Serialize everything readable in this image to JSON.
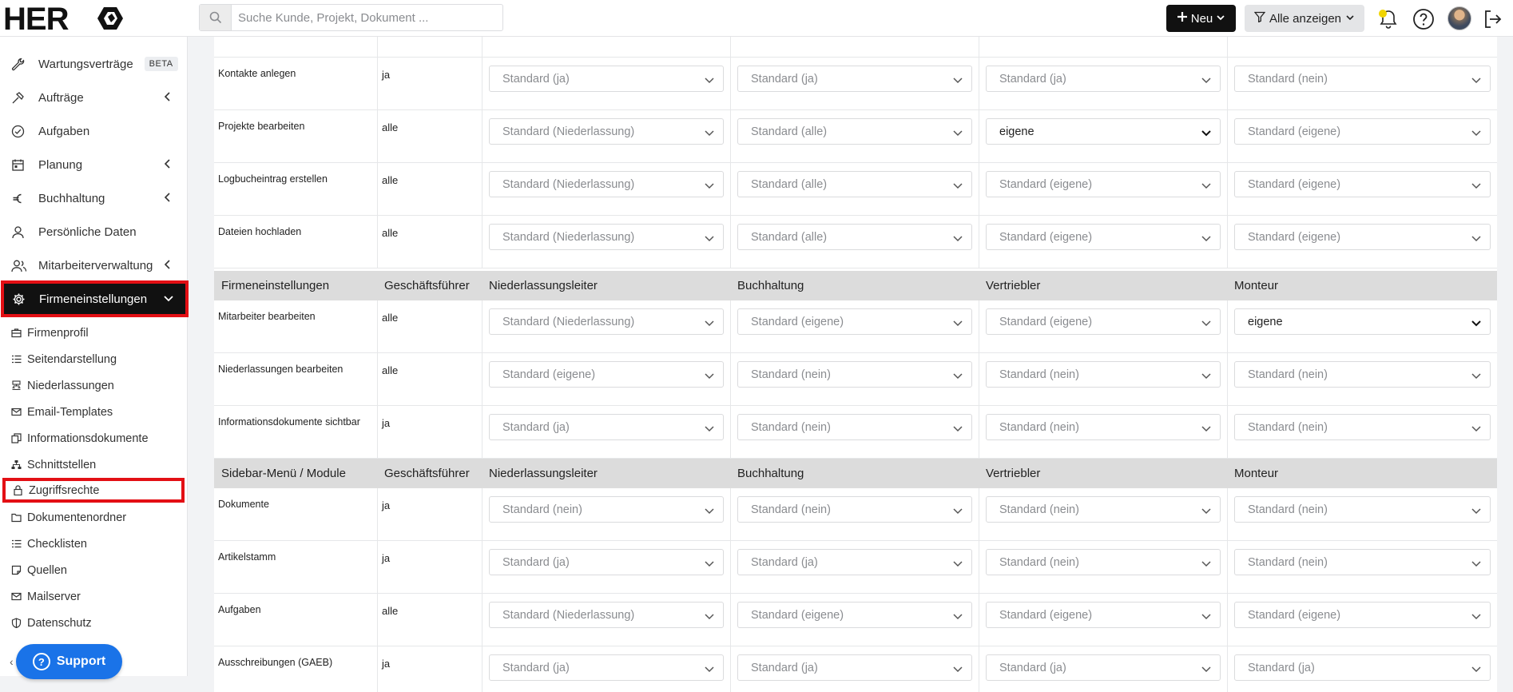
{
  "header": {
    "logo_text": "HERO",
    "search_placeholder": "Suche Kunde, Projekt, Dokument ...",
    "new_label": "Neu",
    "filter_label": "Alle anzeigen"
  },
  "sidebar": {
    "items": [
      {
        "label": "Wartungsverträge",
        "icon": "wrench-icon",
        "badge": "BETA"
      },
      {
        "label": "Aufträge",
        "icon": "hammer-icon"
      },
      {
        "label": "Aufgaben",
        "icon": "check-circle-icon"
      },
      {
        "label": "Planung",
        "icon": "calendar-icon"
      },
      {
        "label": "Buchhaltung",
        "icon": "euro-icon"
      },
      {
        "label": "Persönliche Daten",
        "icon": "user-icon"
      },
      {
        "label": "Mitarbeiterverwaltung",
        "icon": "users-icon"
      },
      {
        "label": "Firmeneinstellungen",
        "icon": "gear-icon"
      }
    ],
    "sub_items": [
      {
        "label": "Firmenprofil",
        "icon": "briefcase-icon"
      },
      {
        "label": "Seitendarstellung",
        "icon": "list-icon"
      },
      {
        "label": "Niederlassungen",
        "icon": "branch-icon"
      },
      {
        "label": "Email-Templates",
        "icon": "envelope-icon"
      },
      {
        "label": "Informationsdokumente",
        "icon": "copy-icon"
      },
      {
        "label": "Schnittstellen",
        "icon": "network-icon"
      },
      {
        "label": "Zugriffsrechte",
        "icon": "lock-icon"
      },
      {
        "label": "Dokumentenordner",
        "icon": "folder-icon"
      },
      {
        "label": "Checklisten",
        "icon": "list-icon"
      },
      {
        "label": "Quellen",
        "icon": "note-icon"
      },
      {
        "label": "Mailserver",
        "icon": "envelope-icon"
      },
      {
        "label": "Datenschutz",
        "icon": "shield-icon"
      }
    ],
    "support_label": "Support"
  },
  "columns": [
    "Geschäftsführer",
    "Niederlassungsleiter",
    "Buchhaltung",
    "Vertriebler",
    "Monteur"
  ],
  "block1": [
    {
      "label": "Kontakte anlegen",
      "value": "ja",
      "selects": [
        {
          "t": "Standard (ja)"
        },
        {
          "t": "Standard (ja)"
        },
        {
          "t": "Standard (ja)"
        },
        {
          "t": "Standard (nein)"
        }
      ]
    },
    {
      "label": "Projekte bearbeiten",
      "value": "alle",
      "selects": [
        {
          "t": "Standard (Niederlassung)"
        },
        {
          "t": "Standard (alle)"
        },
        {
          "t": "eigene",
          "set": true
        },
        {
          "t": "Standard (eigene)"
        }
      ]
    },
    {
      "label": "Logbucheintrag erstellen",
      "value": "alle",
      "selects": [
        {
          "t": "Standard (Niederlassung)"
        },
        {
          "t": "Standard (alle)"
        },
        {
          "t": "Standard (eigene)"
        },
        {
          "t": "Standard (eigene)"
        }
      ]
    },
    {
      "label": "Dateien hochladen",
      "value": "alle",
      "selects": [
        {
          "t": "Standard (Niederlassung)"
        },
        {
          "t": "Standard (alle)"
        },
        {
          "t": "Standard (eigene)"
        },
        {
          "t": "Standard (eigene)"
        }
      ]
    }
  ],
  "section2": {
    "title": "Firmeneinstellungen"
  },
  "block2": [
    {
      "label": "Mitarbeiter bearbeiten",
      "value": "alle",
      "selects": [
        {
          "t": "Standard (Niederlassung)"
        },
        {
          "t": "Standard (eigene)"
        },
        {
          "t": "Standard (eigene)"
        },
        {
          "t": "eigene",
          "set": true
        }
      ]
    },
    {
      "label": "Niederlassungen bearbeiten",
      "value": "alle",
      "selects": [
        {
          "t": "Standard (eigene)"
        },
        {
          "t": "Standard (nein)"
        },
        {
          "t": "Standard (nein)"
        },
        {
          "t": "Standard (nein)"
        }
      ]
    },
    {
      "label": "Informationsdokumente sichtbar",
      "value": "ja",
      "selects": [
        {
          "t": "Standard (ja)"
        },
        {
          "t": "Standard (nein)"
        },
        {
          "t": "Standard (nein)"
        },
        {
          "t": "Standard (nein)"
        }
      ]
    }
  ],
  "section3": {
    "title": "Sidebar-Menü / Module"
  },
  "block3": [
    {
      "label": "Dokumente",
      "value": "ja",
      "selects": [
        {
          "t": "Standard (nein)"
        },
        {
          "t": "Standard (nein)"
        },
        {
          "t": "Standard (nein)"
        },
        {
          "t": "Standard (nein)"
        }
      ]
    },
    {
      "label": "Artikelstamm",
      "value": "ja",
      "selects": [
        {
          "t": "Standard (ja)"
        },
        {
          "t": "Standard (ja)"
        },
        {
          "t": "Standard (nein)"
        },
        {
          "t": "Standard (nein)"
        }
      ]
    },
    {
      "label": "Aufgaben",
      "value": "alle",
      "selects": [
        {
          "t": "Standard (Niederlassung)"
        },
        {
          "t": "Standard (eigene)"
        },
        {
          "t": "Standard (eigene)"
        },
        {
          "t": "Standard (eigene)"
        }
      ]
    },
    {
      "label": "Ausschreibungen (GAEB)",
      "value": "ja",
      "selects": [
        {
          "t": "Standard (ja)"
        },
        {
          "t": "Standard (ja)"
        },
        {
          "t": "Standard (ja)"
        },
        {
          "t": "Standard (ja)"
        }
      ]
    }
  ]
}
